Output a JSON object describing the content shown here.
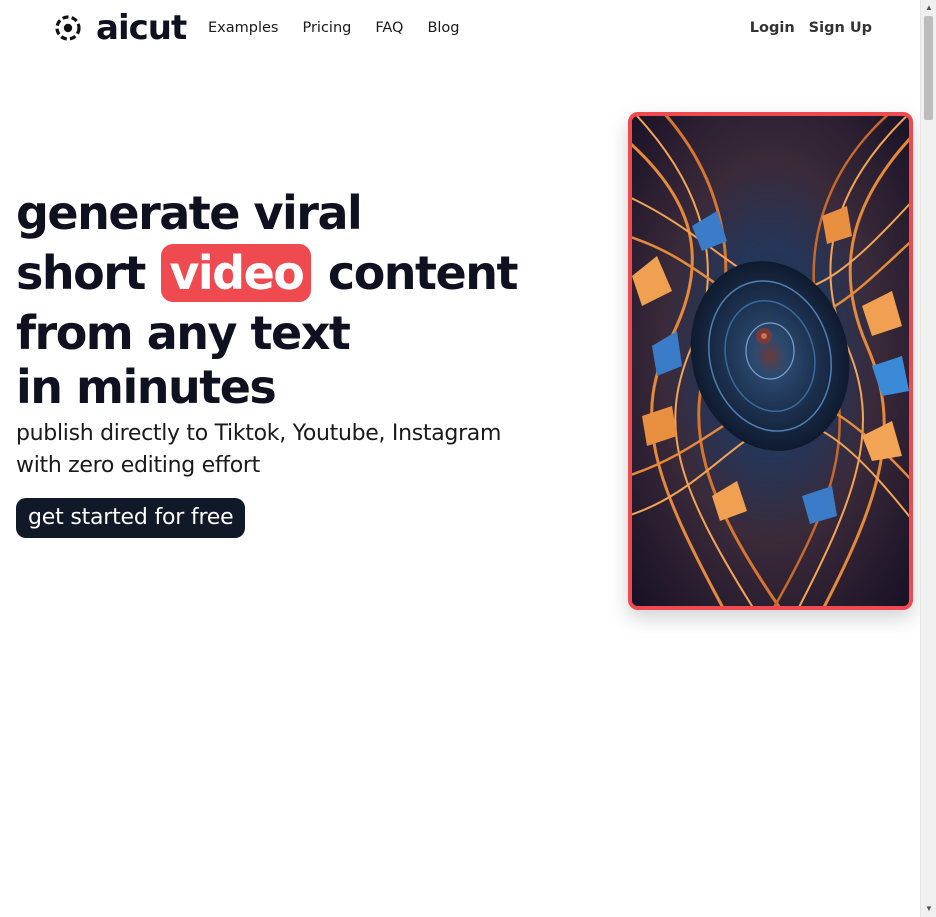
{
  "brand": {
    "name": "aicut",
    "icon": "aicut-logo-icon"
  },
  "nav": {
    "links": [
      "Examples",
      "Pricing",
      "FAQ",
      "Blog"
    ]
  },
  "auth": {
    "login": "Login",
    "signup": "Sign Up"
  },
  "hero": {
    "line1": "generate viral",
    "line2_before": "short",
    "line2_highlight": "video",
    "line2_after": "content",
    "line3": "from any text",
    "line4": "in minutes",
    "subtitle_line1": "publish directly to Tiktok, Youtube, Instagram",
    "subtitle_line2": "with zero editing effort",
    "cta": "get started for free"
  },
  "video": {
    "description_icon": "abstract-video-preview"
  },
  "colors": {
    "accent": "#ef4a4f",
    "dark": "#111827",
    "text": "#0f1020"
  },
  "scrollbar": {
    "up_icon": "scroll-up-arrow-icon",
    "down_icon": "scroll-down-arrow-icon"
  }
}
